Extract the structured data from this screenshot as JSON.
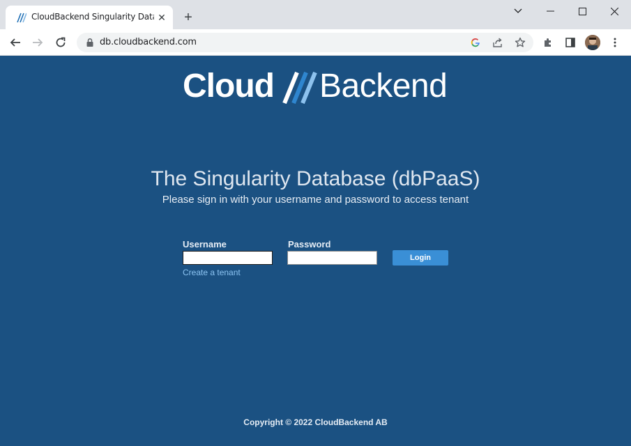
{
  "browser": {
    "tab": {
      "title": "CloudBackend Singularity Database",
      "close_glyph": "✕"
    },
    "new_tab_glyph": "+",
    "window_controls": {
      "minimize": "—",
      "maximize": "☐",
      "close": "✕",
      "tab_search": "⌄"
    },
    "url": "db.cloudbackend.com",
    "icons": [
      "back-icon",
      "forward-icon",
      "reload-icon",
      "lock-icon",
      "google-icon",
      "share-icon",
      "star-icon",
      "extensions-icon",
      "sidepanel-icon",
      "profile-avatar",
      "menu-icon"
    ]
  },
  "page": {
    "logo": {
      "part1": "Cloud",
      "part2": "Backend"
    },
    "headline": "The Singularity Database (dbPaaS)",
    "subline": "Please sign in with your username and password to access tenant",
    "form": {
      "username_label": "Username",
      "username_value": "",
      "password_label": "Password",
      "password_value": "",
      "login_label": "Login",
      "create_tenant": "Create a tenant"
    },
    "copyright": "Copyright © 2022 CloudBackend AB"
  },
  "colors": {
    "page_bg": "#1b5182",
    "button_bg": "#3a8fd6",
    "link": "#8cc4f2",
    "chrome_bg": "#dee1e6"
  }
}
